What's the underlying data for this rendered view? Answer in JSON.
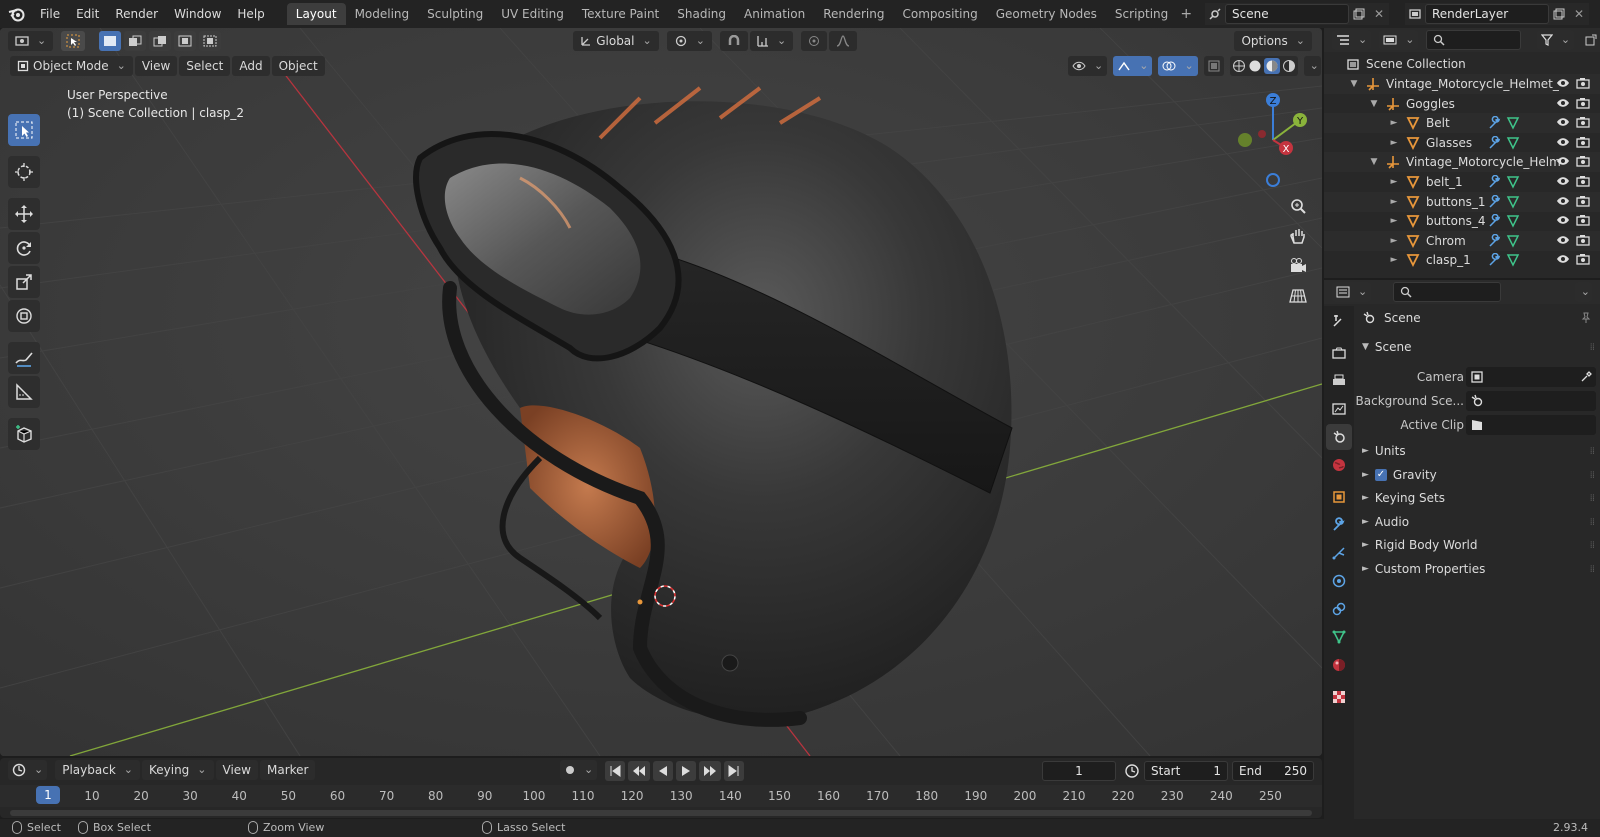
{
  "topbar": {
    "menu": [
      "File",
      "Edit",
      "Render",
      "Window",
      "Help"
    ],
    "workspaces": [
      "Layout",
      "Modeling",
      "Sculpting",
      "UV Editing",
      "Texture Paint",
      "Shading",
      "Animation",
      "Rendering",
      "Compositing",
      "Geometry Nodes",
      "Scripting"
    ],
    "active_workspace": "Layout",
    "add_tab": "+",
    "scene": "Scene",
    "view_layer": "RenderLayer"
  },
  "viewport": {
    "transform_orientation": "Global",
    "options_label": "Options",
    "mode": "Object Mode",
    "menus": [
      "View",
      "Select",
      "Add",
      "Object"
    ],
    "perspective_label": "User Perspective",
    "context_label": "(1) Scene Collection | clasp_2",
    "gizmo": {
      "z": "Z",
      "y": "Y",
      "x": "X"
    }
  },
  "timeline": {
    "menus": [
      "Playback",
      "Keying",
      "View",
      "Marker"
    ],
    "current_frame": "1",
    "start_label": "Start",
    "start": "1",
    "end_label": "End",
    "end": "250",
    "ruler_current": "1",
    "ruler_ticks": [
      "10",
      "20",
      "30",
      "40",
      "50",
      "60",
      "70",
      "80",
      "90",
      "100",
      "110",
      "120",
      "130",
      "140",
      "150",
      "160",
      "170",
      "180",
      "190",
      "200",
      "210",
      "220",
      "230",
      "240",
      "250"
    ]
  },
  "statusbar": {
    "select": "Select",
    "box_select": "Box Select",
    "zoom_view": "Zoom View",
    "lasso_select": "Lasso Select",
    "version": "2.93.4"
  },
  "outliner": {
    "root": "Scene Collection",
    "items": [
      {
        "label": "Vintage_Motorcycle_Helmet_",
        "type": "empty",
        "depth": 1,
        "expanded": true
      },
      {
        "label": "Goggles",
        "type": "empty",
        "depth": 2,
        "expanded": true
      },
      {
        "label": "Belt",
        "type": "mesh",
        "depth": 3,
        "expanded": false
      },
      {
        "label": "Glasses",
        "type": "mesh",
        "depth": 3,
        "expanded": false
      },
      {
        "label": "Vintage_Motorcycle_Helm",
        "type": "empty",
        "depth": 2,
        "expanded": true
      },
      {
        "label": "belt_1",
        "type": "mesh",
        "depth": 3,
        "expanded": false
      },
      {
        "label": "buttons_1",
        "type": "mesh",
        "depth": 3,
        "expanded": false
      },
      {
        "label": "buttons_4",
        "type": "mesh",
        "depth": 3,
        "expanded": false
      },
      {
        "label": "Chrom",
        "type": "mesh",
        "depth": 3,
        "expanded": false
      },
      {
        "label": "clasp_1",
        "type": "mesh",
        "depth": 3,
        "expanded": false
      }
    ]
  },
  "properties": {
    "context": "Scene",
    "panel_scene": "Scene",
    "camera_label": "Camera",
    "background_label": "Background Sce...",
    "active_clip_label": "Active Clip",
    "panels": [
      {
        "label": "Units",
        "checkbox": false
      },
      {
        "label": "Gravity",
        "checkbox": true
      },
      {
        "label": "Keying Sets",
        "checkbox": false
      },
      {
        "label": "Audio",
        "checkbox": false
      },
      {
        "label": "Rigid Body World",
        "checkbox": false
      },
      {
        "label": "Custom Properties",
        "checkbox": false
      }
    ]
  },
  "colors": {
    "accent": "#4772b3",
    "x_axis": "#c4343f",
    "y_axis": "#8ab33b",
    "z_axis": "#3b7ed8",
    "mesh_icon": "#e8973b",
    "modifier_icon": "#5da4e6",
    "data_icon": "#3fc48a"
  }
}
